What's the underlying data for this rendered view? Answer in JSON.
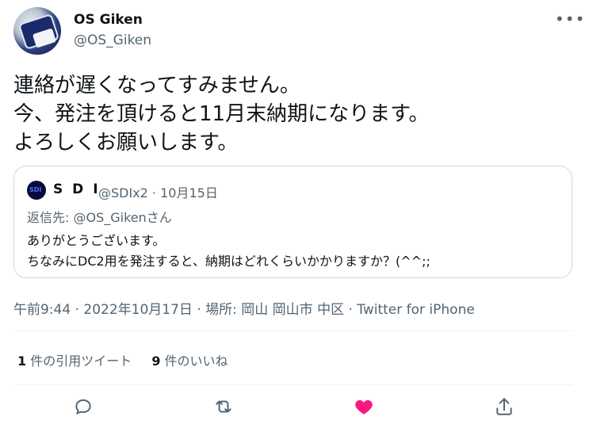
{
  "author": {
    "name": "OS Giken",
    "handle": "@OS_Giken"
  },
  "menu_icon": "more-icon",
  "tweet_lines": [
    "連絡が遅くなってすみません。",
    "今、発注を頂けると11月末納期になります。",
    "よろしくお願いします。"
  ],
  "quote": {
    "avatar_text": "SDI",
    "name": "S D I",
    "meta": "@SDIx2 · 10月15日",
    "reply_to": "返信先: @OS_Gikenさん",
    "lines": [
      "ありがとうございます。",
      "ちなみにDC2用を発注すると、納期はどれくらいかかりますか？(^^;;"
    ]
  },
  "meta_line": "午前9:44 · 2022年10月17日 · 場所: 岡山 岡山市 中区 · Twitter for iPhone",
  "stats": {
    "quotes_count": "1",
    "quotes_label": " 件の引用ツイート",
    "likes_count": "9",
    "likes_label": " 件のいいね"
  },
  "actions": {
    "reply_icon": "reply-icon",
    "retweet_icon": "retweet-icon",
    "like_icon": "heart-icon",
    "share_icon": "share-icon",
    "like_color": "#f91880"
  }
}
